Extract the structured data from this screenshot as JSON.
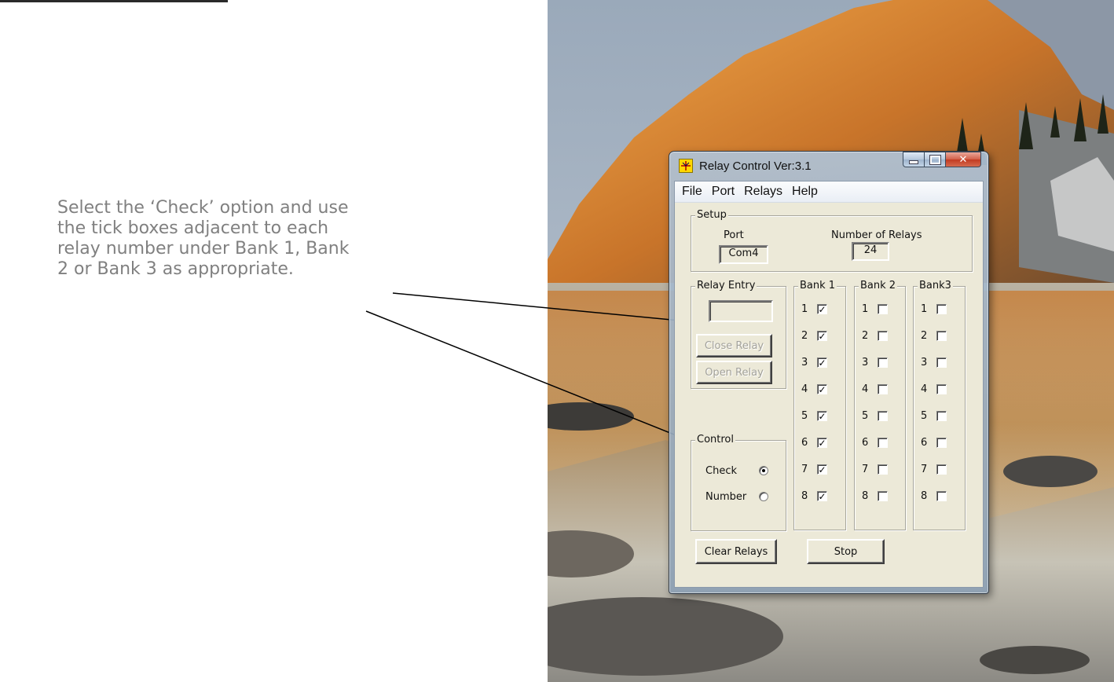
{
  "instruction_text": "Select the ‘Check’ option and use the tick boxes adjacent to each relay number under Bank 1, Bank 2 or Bank 3 as appropriate.",
  "window": {
    "title": "Relay Control Ver:3.1",
    "icon": "relay-app-icon",
    "caption_buttons": {
      "minimize": "minimize-icon",
      "maximize": "maximize-icon",
      "close": "✕"
    }
  },
  "menu": [
    "File",
    "Port",
    "Relays",
    "Help"
  ],
  "setup": {
    "title": "Setup",
    "port_label": "Port",
    "port_value": "Com4",
    "relays_label": "Number of Relays",
    "relays_value": "24"
  },
  "relay_entry": {
    "title": "Relay Entry",
    "value": "",
    "close_button": "Close Relay",
    "open_button": "Open Relay"
  },
  "control": {
    "title": "Control",
    "check_label": "Check",
    "number_label": "Number",
    "selected": "Check"
  },
  "banks": [
    {
      "title": "Bank 1",
      "relays": [
        {
          "n": "1",
          "checked": true
        },
        {
          "n": "2",
          "checked": true
        },
        {
          "n": "3",
          "checked": true
        },
        {
          "n": "4",
          "checked": true
        },
        {
          "n": "5",
          "checked": true
        },
        {
          "n": "6",
          "checked": true
        },
        {
          "n": "7",
          "checked": true
        },
        {
          "n": "8",
          "checked": true
        }
      ]
    },
    {
      "title": "Bank 2",
      "relays": [
        {
          "n": "1",
          "checked": false
        },
        {
          "n": "2",
          "checked": false
        },
        {
          "n": "3",
          "checked": false
        },
        {
          "n": "4",
          "checked": false
        },
        {
          "n": "5",
          "checked": false
        },
        {
          "n": "6",
          "checked": false
        },
        {
          "n": "7",
          "checked": false
        },
        {
          "n": "8",
          "checked": false
        }
      ]
    },
    {
      "title": "Bank3",
      "relays": [
        {
          "n": "1",
          "checked": false
        },
        {
          "n": "2",
          "checked": false
        },
        {
          "n": "3",
          "checked": false
        },
        {
          "n": "4",
          "checked": false
        },
        {
          "n": "5",
          "checked": false
        },
        {
          "n": "6",
          "checked": false
        },
        {
          "n": "7",
          "checked": false
        },
        {
          "n": "8",
          "checked": false
        }
      ]
    }
  ],
  "buttons": {
    "clear": "Clear Relays",
    "stop": "Stop"
  },
  "colors": {
    "dialog_face": "#ece9d8",
    "instruction_text": "#808080",
    "sky": "#9fb1c4",
    "rock_glow": "#d9822b"
  }
}
